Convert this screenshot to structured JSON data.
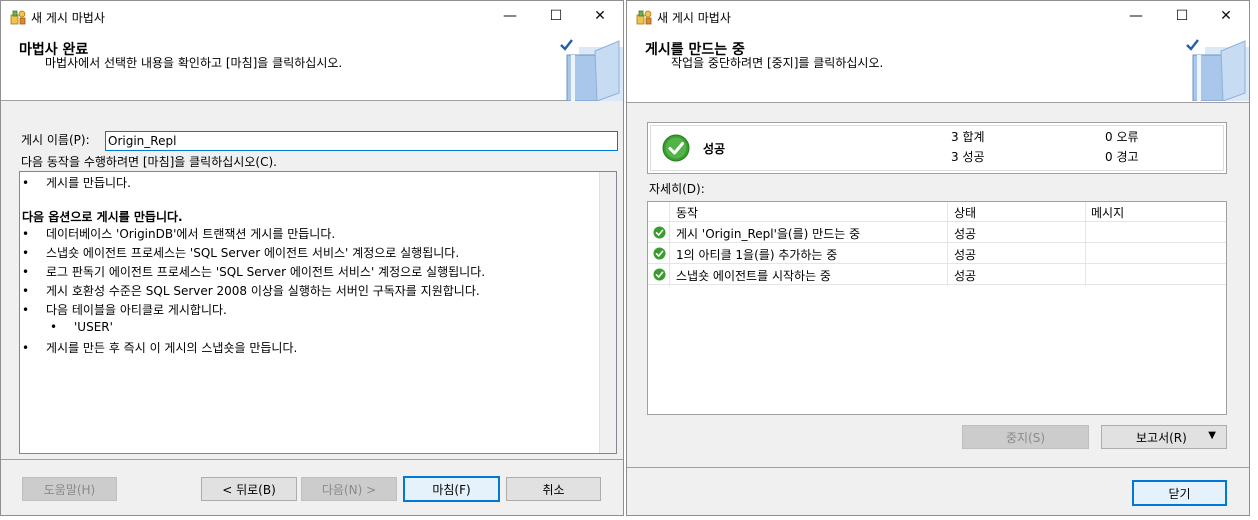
{
  "wizard_left": {
    "title": "새 게시 마법사",
    "banner": {
      "title": "마법사 완료",
      "subtitle": "마법사에서 선택한 내용을 확인하고 [마침]을 클릭하십시오."
    },
    "publication_name_label": "게시 이름(P):",
    "publication_name_value": "Origin_Repl",
    "instruction": "다음 동작을 수행하려면 [마침]을 클릭하십시오(C).",
    "summary": {
      "line1": "게시를 만듭니다.",
      "options_heading": "다음 옵션으로 게시를 만듭니다.",
      "opt1": "데이터베이스 'OriginDB'에서 트랜잭션 게시를 만듭니다.",
      "opt2": "스냅숏 에이전트 프로세스는 'SQL Server 에이전트 서비스' 계정으로 실행됩니다.",
      "opt3": "로그 판독기 에이전트 프로세스는 'SQL Server 에이전트 서비스' 계정으로 실행됩니다.",
      "opt4": "게시 호환성 수준은 SQL Server 2008 이상을 실행하는 서버인 구독자를 지원합니다.",
      "opt5": "다음 테이블을 아티클로 게시합니다.",
      "article1": "'USER'",
      "opt6": "게시를 만든 후 즉시 이 게시의 스냅숏을 만듭니다."
    },
    "buttons": {
      "help": "도움말(H)",
      "back": "< 뒤로(B)",
      "next": "다음(N) >",
      "finish": "마침(F)",
      "cancel": "취소"
    }
  },
  "wizard_right": {
    "title": "새 게시 마법사",
    "banner": {
      "title": "게시를 만드는 중",
      "subtitle": "작업을 중단하려면 [중지]를 클릭하십시오."
    },
    "status": {
      "result": "성공",
      "total": "3 합계",
      "success": "3 성공",
      "error": "0 오류",
      "warning": "0 경고"
    },
    "details_label": "자세히(D):",
    "columns": {
      "action": "동작",
      "status": "상태",
      "message": "메시지"
    },
    "rows": [
      {
        "action": "게시 'Origin_Repl'을(를) 만드는 중",
        "status": "성공",
        "message": ""
      },
      {
        "action": "1의 아티클 1을(를) 추가하는 중",
        "status": "성공",
        "message": ""
      },
      {
        "action": "스냅숏 에이전트를 시작하는 중",
        "status": "성공",
        "message": ""
      }
    ],
    "buttons": {
      "stop": "중지(S)",
      "report": "보고서(R)",
      "close": "닫기"
    }
  },
  "titlebar_buttons": {
    "minimize": "—",
    "maximize": "☐",
    "close": "✕"
  },
  "colors": {
    "accent": "#0078d7",
    "success_green": "#3a9c2f"
  }
}
